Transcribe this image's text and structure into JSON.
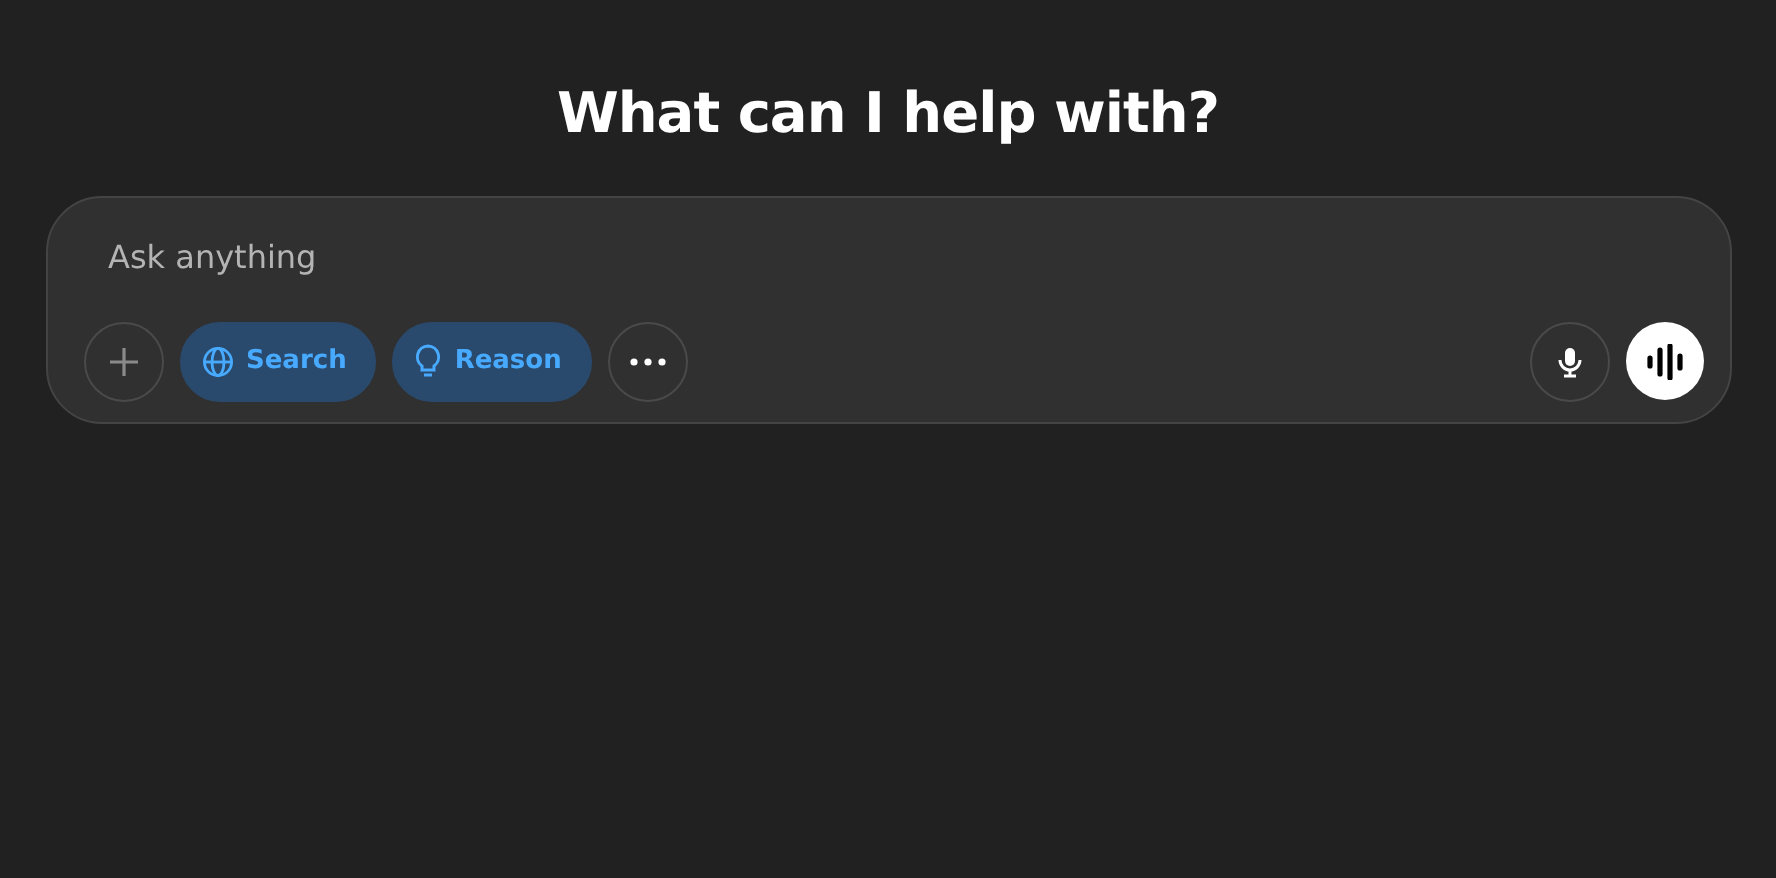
{
  "heading": "What can I help with?",
  "composer": {
    "placeholder": "Ask anything",
    "tools": [
      {
        "label": "Search",
        "kind": "globe",
        "selected": true
      },
      {
        "label": "Reason",
        "kind": "bulb",
        "selected": true
      }
    ]
  }
}
